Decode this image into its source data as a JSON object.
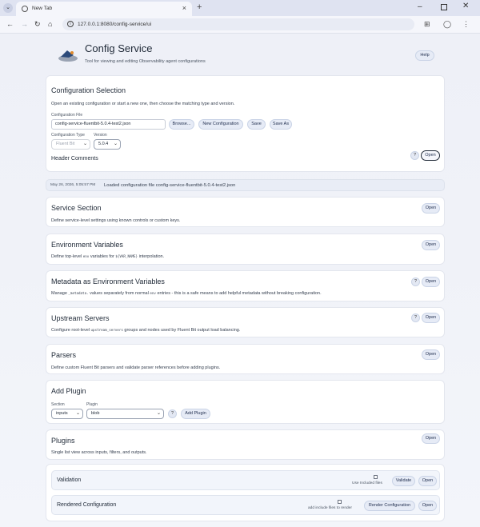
{
  "browser": {
    "tab_title": "New Tab",
    "url": "127.0.0.1:8080/config-service/ui"
  },
  "header": {
    "title": "Config Service",
    "subtitle": "Tool for viewing and editing Observability agent configurations",
    "help_label": "Help"
  },
  "config_selection": {
    "title": "Configuration Selection",
    "description": "Open an existing configuration or start a new one, then choose the matching type and version.",
    "file_label": "Configuration File",
    "file_value": "config-service-fluentbit-5.0.4-test2.json",
    "browse_label": "Browse...",
    "new_label": "New Configuration",
    "save_label": "Save",
    "save_as_label": "Save As",
    "type_label": "Configuration Type",
    "type_value": "Fluent Bit",
    "version_label": "Version",
    "version_value": "5.0.4",
    "header_comments_label": "Header Comments",
    "help_q": "?",
    "open_label": "Open"
  },
  "status": {
    "timestamp": "May 26, 2026, 5:05:57 PM",
    "message": "Loaded configuration file config-service-fluentbit-5.0.4-test2.json"
  },
  "sections": {
    "service": {
      "title": "Service Section",
      "desc": "Define service-level settings using known controls or custom keys.",
      "open": "Open"
    },
    "env": {
      "title": "Environment Variables",
      "desc_pre": "Define top-level ",
      "desc_code1": "env",
      "desc_mid": " variables for ",
      "desc_code2": "${VAR_NAME}",
      "desc_post": " interpolation.",
      "open": "Open"
    },
    "meta": {
      "title": "Metadata as Environment Variables",
      "desc_pre": "Manage ",
      "desc_code1": "_metadata.",
      "desc_mid": " values separately from normal ",
      "desc_code2": "env",
      "desc_post": " entries - this is a safe means to add helpful metadata without breaking configuration.",
      "q": "?",
      "open": "Open"
    },
    "upstream": {
      "title": "Upstream Servers",
      "desc_pre": "Configure root-level ",
      "desc_code1": "upstream_servers",
      "desc_post": " groups and nodes used by Fluent Bit output load balancing.",
      "q": "?",
      "open": "Open"
    },
    "parsers": {
      "title": "Parsers",
      "desc": "Define custom Fluent Bit parsers and validate parser references before adding plugins.",
      "open": "Open"
    },
    "add_plugin": {
      "title": "Add Plugin",
      "section_label": "Section",
      "section_value": "inputs",
      "plugin_label": "Plugin",
      "plugin_value": "blob",
      "q": "?",
      "add_label": "Add Plugin"
    },
    "plugins": {
      "title": "Plugins",
      "desc": "Single list view across inputs, filters, and outputs.",
      "open": "Open"
    },
    "validation": {
      "title": "Validation",
      "checkbox_label": "Use Included files",
      "validate_label": "Validate",
      "open": "Open"
    },
    "rendered": {
      "title": "Rendered Configuration",
      "checkbox_label": "add include files to render",
      "render_label": "Render Configuration",
      "open": "Open"
    }
  }
}
